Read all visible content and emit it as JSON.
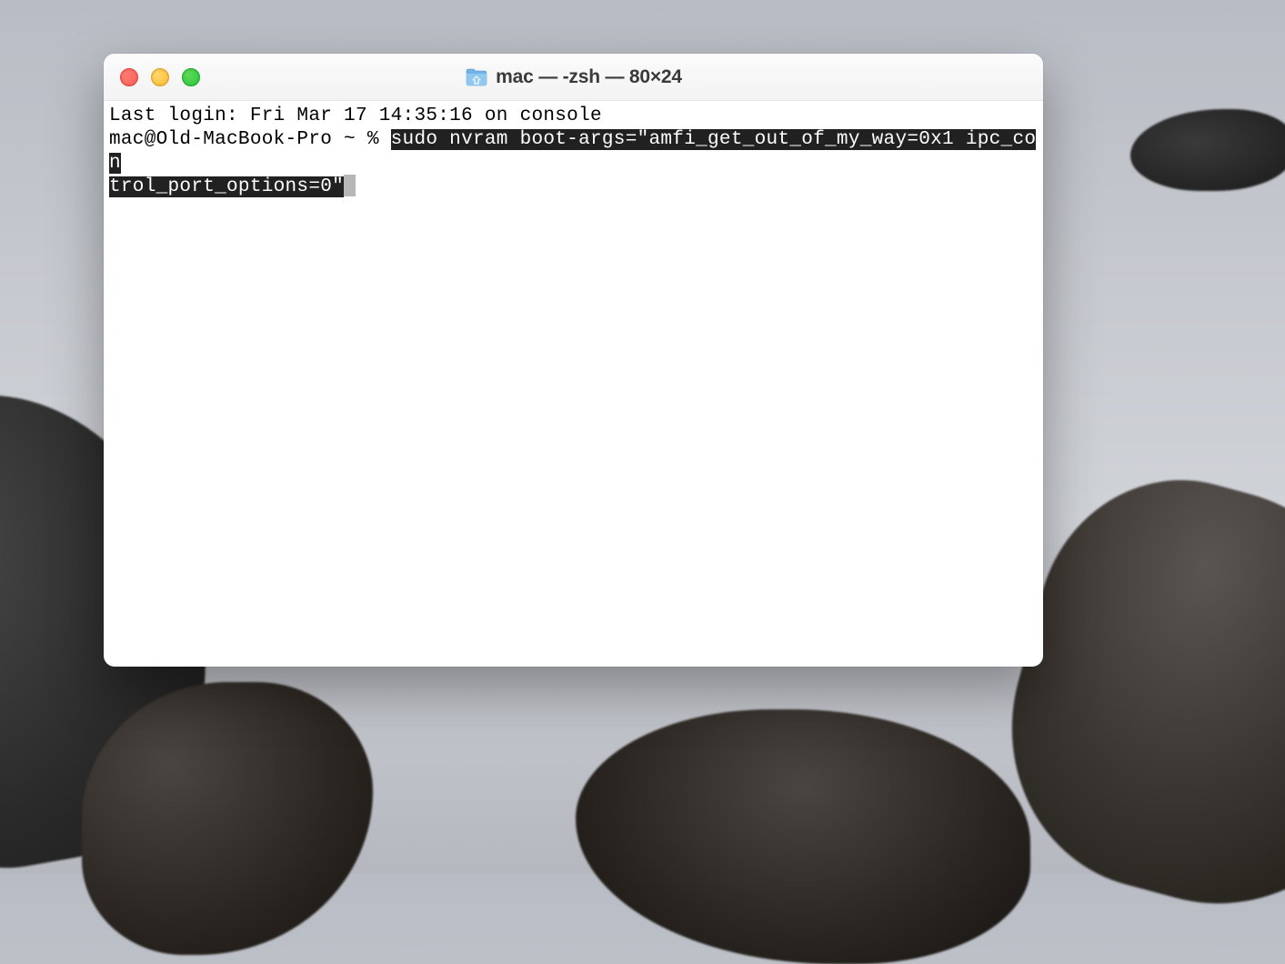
{
  "window": {
    "title": "mac — -zsh — 80×24",
    "icon": "home-folder-icon"
  },
  "traffic_lights": {
    "close": "close",
    "minimize": "minimize",
    "zoom": "zoom"
  },
  "terminal": {
    "last_login": "Last login: Fri Mar 17 14:35:16 on console",
    "prompt": "mac@Old-MacBook-Pro ~ % ",
    "command_line1": "sudo nvram boot-args=\"amfi_get_out_of_my_way=0x1 ipc_con",
    "command_line2": "trol_port_options=0\""
  }
}
